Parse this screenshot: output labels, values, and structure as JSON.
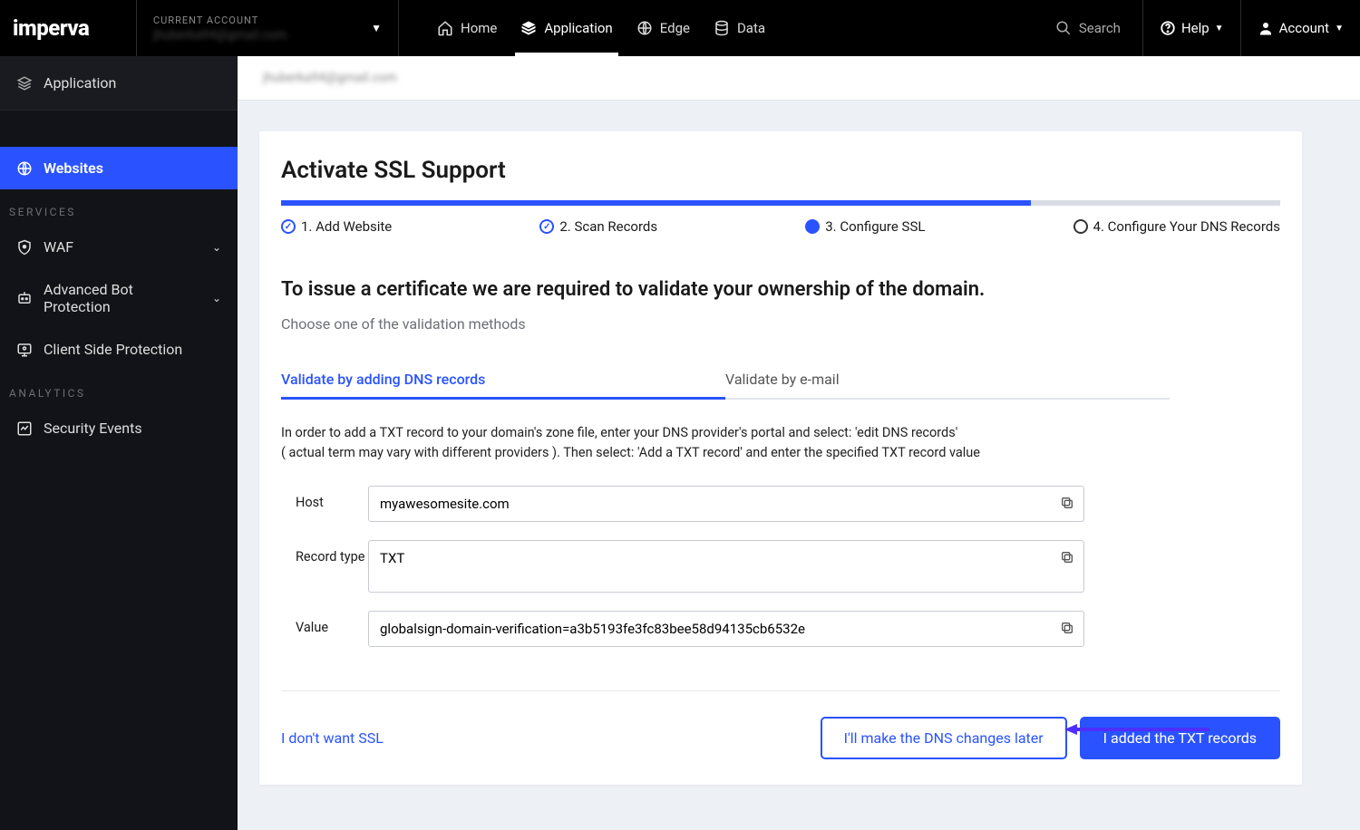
{
  "brand": "imperva",
  "currentAccount": {
    "label": "CURRENT ACCOUNT",
    "email": "jhuberka94@gmail.com"
  },
  "topNav": {
    "home": "Home",
    "application": "Application",
    "edge": "Edge",
    "data": "Data",
    "search": "Search",
    "help": "Help",
    "account": "Account"
  },
  "sidebar": {
    "header": "Application",
    "websites": "Websites",
    "servicesLabel": "SERVICES",
    "waf": "WAF",
    "abp": "Advanced Bot Protection",
    "csp": "Client Side Protection",
    "analyticsLabel": "ANALYTICS",
    "securityEvents": "Security Events"
  },
  "breadcrumbEmail": "jhuberka94@gmail.com",
  "card": {
    "title": "Activate SSL Support",
    "steps": {
      "s1": "1. Add Website",
      "s2": "2. Scan Records",
      "s3": "3. Configure SSL",
      "s4": "4. Configure Your DNS Records"
    },
    "heading": "To issue a certificate we are required to validate your ownership of the domain.",
    "sub": "Choose one of the validation methods",
    "tabs": {
      "dns": "Validate by adding DNS records",
      "email": "Validate by e-mail"
    },
    "desc1": "In order to add a TXT record to your domain's zone file, enter your DNS provider's portal and select: 'edit DNS records'",
    "desc2": "( actual term may vary with different providers ). Then select: 'Add a TXT record' and enter the specified TXT record value",
    "form": {
      "hostLabel": "Host",
      "hostValue": "myawesomesite.com",
      "typeLabel": "Record type",
      "typeValue": "TXT",
      "valueLabel": "Value",
      "valueValue": "globalsign-domain-verification=a3b5193fe3fc83bee58d94135cb6532e"
    },
    "footer": {
      "skip": "I don't want SSL",
      "later": "I'll make the DNS changes later",
      "done": "I added the TXT records"
    }
  }
}
